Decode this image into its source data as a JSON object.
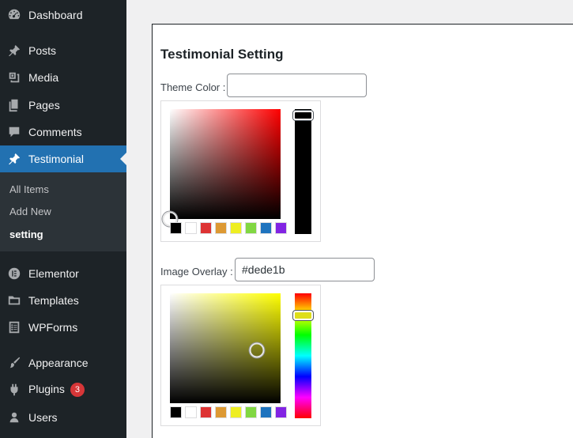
{
  "sidebar": {
    "top_items": [
      {
        "label": "Dashboard",
        "icon": "dashboard-icon"
      },
      {
        "label": "Posts",
        "icon": "pushpin-icon"
      },
      {
        "label": "Media",
        "icon": "media-icon"
      },
      {
        "label": "Pages",
        "icon": "pages-icon"
      },
      {
        "label": "Comments",
        "icon": "comment-icon"
      },
      {
        "label": "Testimonial",
        "icon": "pushpin-icon"
      }
    ],
    "submenu": [
      "All Items",
      "Add New",
      "setting"
    ],
    "bottom_items": [
      {
        "label": "Elementor",
        "icon": "elementor-icon"
      },
      {
        "label": "Templates",
        "icon": "folder-icon"
      },
      {
        "label": "WPForms",
        "icon": "wpforms-icon"
      },
      {
        "label": "Appearance",
        "icon": "paintbrush-icon"
      },
      {
        "label": "Plugins",
        "icon": "plugin-icon",
        "badge": "3"
      },
      {
        "label": "Users",
        "icon": "user-icon"
      }
    ],
    "active_item": "Testimonial",
    "current_submenu": "setting"
  },
  "page": {
    "title": "Testimonial Setting",
    "theme_color": {
      "label": "Theme Color :",
      "value": "",
      "hue_color": "#ff0000",
      "strip_color": "#000000"
    },
    "image_overlay": {
      "label": "Image Overlay :",
      "value": "#dede1b",
      "hue_color": "#ffff00",
      "handle_color": "#dede1b"
    },
    "palette": [
      "#000000",
      "#ffffff",
      "#dd3333",
      "#dd9933",
      "#eeee22",
      "#81d742",
      "#1e73be",
      "#8224e3"
    ]
  },
  "colors": {
    "sidebar_bg": "#1d2327",
    "submenu_bg": "#2c3338",
    "accent": "#2271b1",
    "badge": "#d63638"
  }
}
